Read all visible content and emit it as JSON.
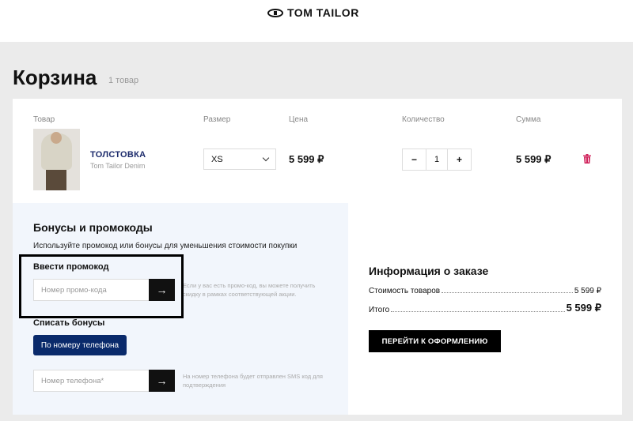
{
  "brand": {
    "logo_text": "TOM TAILOR"
  },
  "page": {
    "title": "Корзина",
    "item_count": "1 товар"
  },
  "table": {
    "headers": {
      "product": "Товар",
      "size": "Размер",
      "price": "Цена",
      "quantity": "Количество",
      "sum": "Сумма"
    }
  },
  "item": {
    "name": "ТОЛСТОВКА",
    "brand": "Tom Tailor Denim",
    "size": "XS",
    "price": "5 599 ₽",
    "quantity": "1",
    "sum": "5 599 ₽",
    "decrement": "−",
    "increment": "+"
  },
  "promo": {
    "title": "Бонусы и промокоды",
    "description": "Используйте промокод или бонусы для уменьшения стоимости покупки",
    "code_label": "Ввести промокод",
    "code_placeholder": "Номер промо-кода",
    "code_hint": "Если у вас есть промо-код, вы можете получить скидку в рамках соответствующей акции.",
    "bonus_label": "Списать бонусы",
    "phone_button": "По номеру телефона",
    "phone_placeholder": "Номер телефона*",
    "phone_hint": "На номер телефона будет отправлен SMS код для подтверждения",
    "submit_arrow": "→"
  },
  "order": {
    "title": "Информация о заказе",
    "goods_label": "Стоимость товаров",
    "goods_value": "5 599 ₽",
    "total_label": "Итого",
    "total_value": "5 599 ₽",
    "checkout_button": "ПЕРЕЙТИ К ОФОРМЛЕНИЮ"
  },
  "colors": {
    "accent_navy": "#0a2a6b",
    "delete_icon": "#d0205a",
    "promo_panel_bg": "#f2f6fc"
  }
}
